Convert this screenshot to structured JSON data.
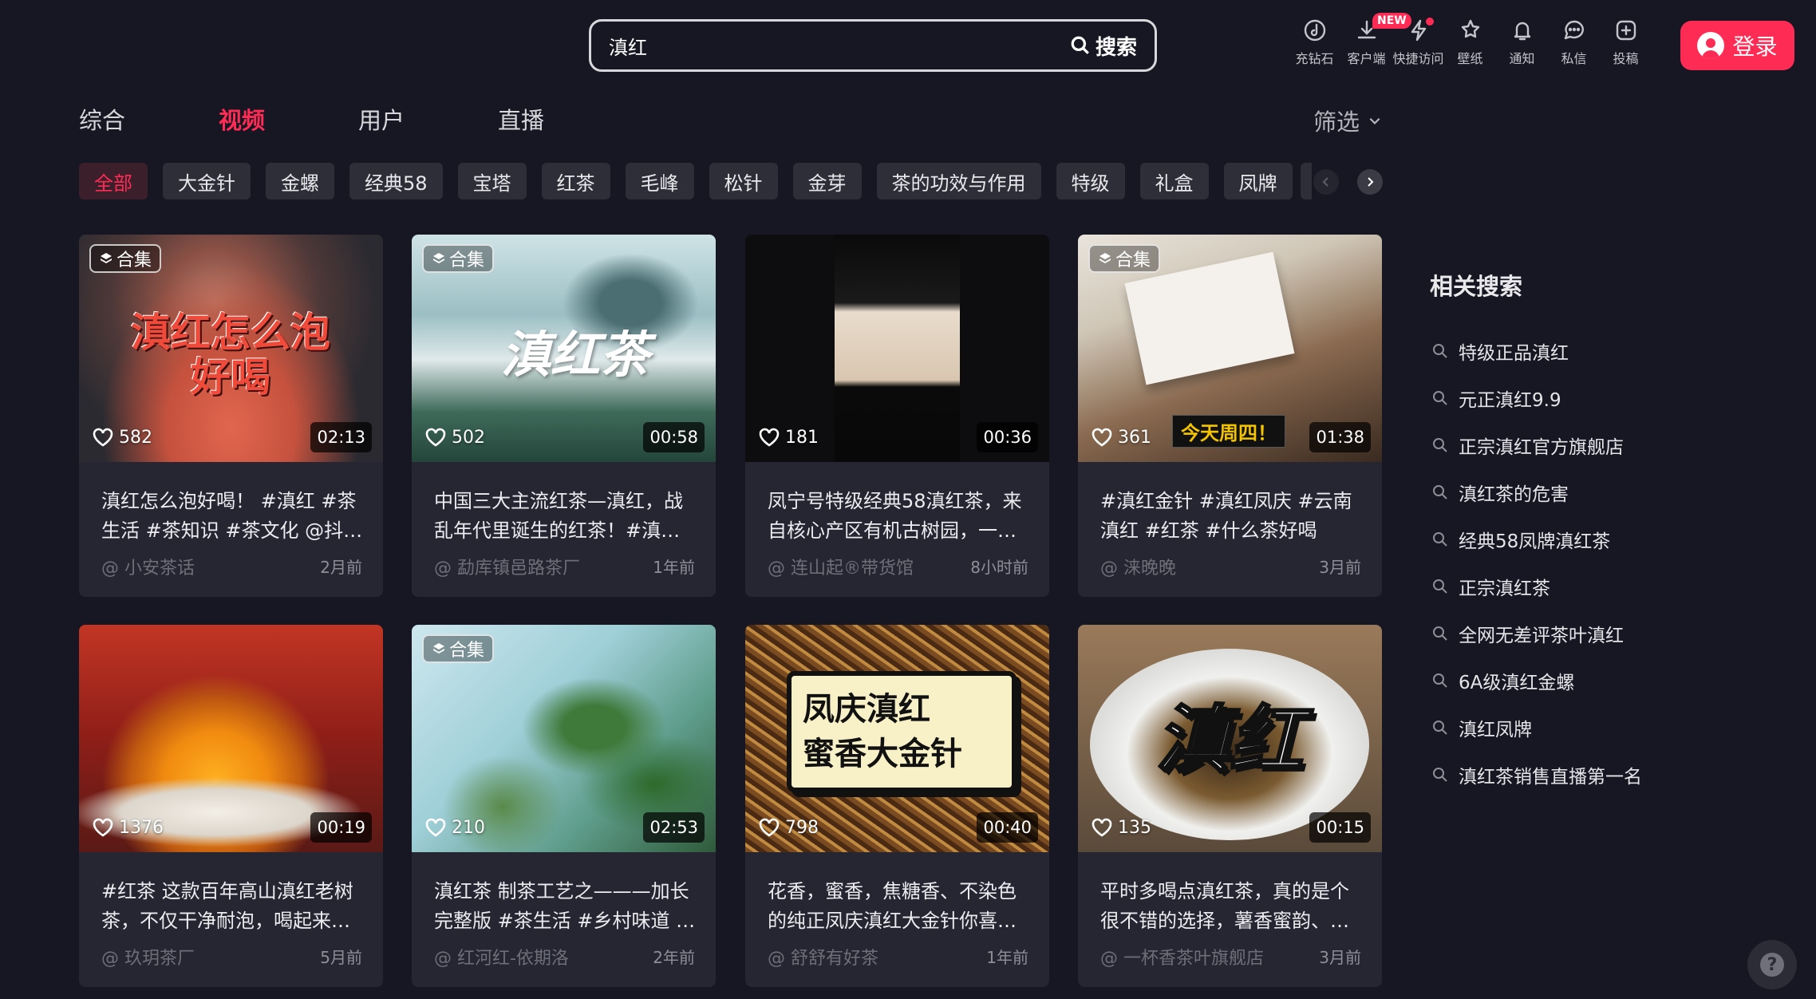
{
  "search": {
    "value": "滇红",
    "button_label": "搜索"
  },
  "header": {
    "icons": [
      {
        "label": "充钻石",
        "icon": "diamond-icon"
      },
      {
        "label": "客户端",
        "icon": "download-icon",
        "badge": "NEW"
      },
      {
        "label": "快捷访问",
        "icon": "lightning-icon"
      },
      {
        "label": "壁纸",
        "icon": "wallpaper-icon"
      },
      {
        "label": "通知",
        "icon": "bell-icon"
      },
      {
        "label": "私信",
        "icon": "message-icon"
      },
      {
        "label": "投稿",
        "icon": "upload-icon"
      }
    ],
    "login_label": "登录"
  },
  "tabs": [
    {
      "label": "综合"
    },
    {
      "label": "视频",
      "active": true
    },
    {
      "label": "用户"
    },
    {
      "label": "直播"
    }
  ],
  "filter_label": "筛选",
  "chips": [
    "全部",
    "大金针",
    "金螺",
    "经典58",
    "宝塔",
    "红茶",
    "毛峰",
    "松针",
    "金芽",
    "茶的功效与作用",
    "特级",
    "礼盒",
    "凤牌"
  ],
  "videos": [
    {
      "collection": "合集",
      "thumb_text": "滇红怎么泡\n好喝",
      "likes": "582",
      "duration": "02:13",
      "caption": "滇红怎么泡好喝！ #滇红 #茶生活 #茶知识 #茶文化 @抖…",
      "author": "@ 小安茶话",
      "date": "2月前"
    },
    {
      "collection": "合集",
      "thumb_text": "滇红茶",
      "likes": "502",
      "duration": "00:58",
      "caption": "中国三大主流红茶—滇红，战乱年代里诞生的红茶！#滇…",
      "author": "@ 勐库镇邑路茶厂",
      "date": "1年前"
    },
    {
      "collection": "",
      "thumb_text": "",
      "likes": "181",
      "duration": "00:36",
      "caption": "凤宁号特级经典58滇红茶，来自核心产区有机古树园，一…",
      "author": "@ 连山起®带货馆",
      "date": "8小时前"
    },
    {
      "collection": "合集",
      "thumb_text": "今天周四！",
      "likes": "361",
      "duration": "01:38",
      "caption": "#滇红金针 #滇红凤庆 #云南滇红 #红茶 #什么茶好喝",
      "author": "@ 涞晚晚",
      "date": "3月前"
    },
    {
      "collection": "",
      "thumb_text": "",
      "likes": "1376",
      "duration": "00:19",
      "caption": "#红茶 这款百年高山滇红老树茶，不仅干净耐泡，喝起来…",
      "author": "@ 玖玥茶厂",
      "date": "5月前"
    },
    {
      "collection": "合集",
      "thumb_text": "",
      "likes": "210",
      "duration": "02:53",
      "caption": "滇红茶 制茶工艺之———加长完整版 #茶生活 #乡村味道 …",
      "author": "@ 红河红-依期洛",
      "date": "2年前"
    },
    {
      "collection": "",
      "thumb_text": "凤庆滇红\n蜜香大金针",
      "likes": "798",
      "duration": "00:40",
      "caption": "花香，蜜香，焦糖香、不染色的纯正凤庆滇红大金针你喜…",
      "author": "@ 舒舒有好茶",
      "date": "1年前"
    },
    {
      "collection": "",
      "thumb_text": "滇红",
      "likes": "135",
      "duration": "00:15",
      "caption": "平时多喝点滇红茶，真的是个很不错的选择，薯香蜜韵、…",
      "author": "@ 一杯香茶叶旗舰店",
      "date": "3月前"
    }
  ],
  "related": {
    "title": "相关搜索",
    "items": [
      "特级正品滇红",
      "元正滇红9.9",
      "正宗滇红官方旗舰店",
      "滇红茶的危害",
      "经典58凤牌滇红茶",
      "正宗滇红茶",
      "全网无差评茶叶滇红",
      "6A级滇红金螺",
      "滇红凤牌",
      "滇红茶销售直播第一名"
    ]
  },
  "colors": {
    "accent": "#fe2c55",
    "background": "#161722",
    "card": "#252632"
  }
}
